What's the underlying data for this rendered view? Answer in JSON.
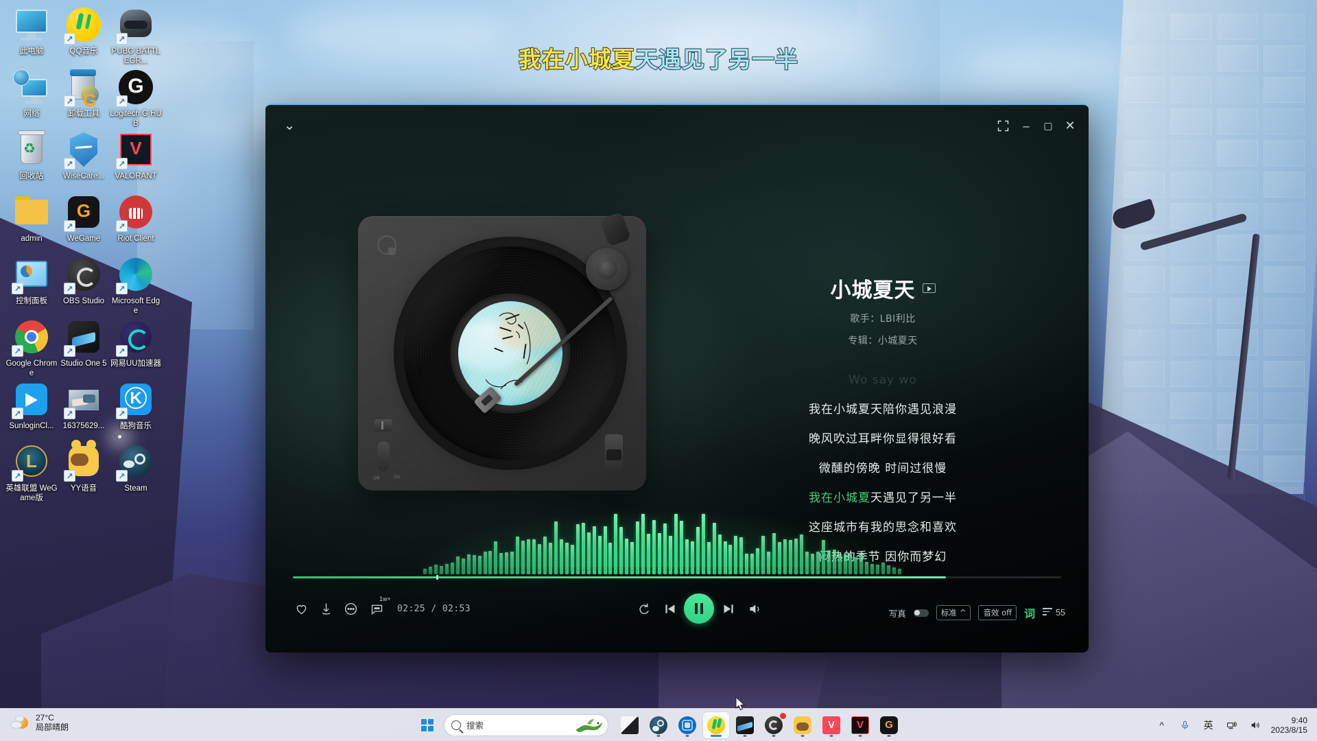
{
  "desktop": {
    "icons": [
      {
        "label": "此电脑",
        "art": "monitor"
      },
      {
        "label": "QQ音乐",
        "art": "qq"
      },
      {
        "label": "PUBG BATTLEGR...",
        "art": "pubg"
      },
      {
        "label": "网络",
        "art": "network"
      },
      {
        "label": "卸载工具",
        "art": "uninstall"
      },
      {
        "label": "Logitech G HUB",
        "art": "ghub"
      },
      {
        "label": "回收站",
        "art": "recyclebin"
      },
      {
        "label": "WiseCare...",
        "art": "wisecare"
      },
      {
        "label": "VALORANT",
        "art": "valorant"
      },
      {
        "label": "admin",
        "art": "folder"
      },
      {
        "label": "WeGame",
        "art": "wegame"
      },
      {
        "label": "Riot Client",
        "art": "riot"
      },
      {
        "label": "控制面板",
        "art": "cpanel"
      },
      {
        "label": "OBS Studio",
        "art": "obs"
      },
      {
        "label": "Microsoft Edge",
        "art": "edge"
      },
      {
        "label": "Google Chrome",
        "art": "chrome"
      },
      {
        "label": "Studio One 5",
        "art": "studioone"
      },
      {
        "label": "网易UU加速器",
        "art": "uu"
      },
      {
        "label": "SunloginCl...",
        "art": "sunlogin"
      },
      {
        "label": "16375629...",
        "art": "photo"
      },
      {
        "label": "酷狗音乐",
        "art": "kugou"
      },
      {
        "label": "英雄联盟 WeGame版",
        "art": "lol"
      },
      {
        "label": "YY语音",
        "art": "yy"
      },
      {
        "label": "Steam",
        "art": "steam"
      }
    ]
  },
  "desktop_lyric": {
    "sung": "我在小城夏",
    "unsung": "天遇见了另一半"
  },
  "player": {
    "titlebar": {
      "collapse_icon": "chevron-down",
      "expand_label": "⛶",
      "minimize_label": "–",
      "maximize_label": "▢",
      "close_label": "✕"
    },
    "song": {
      "title": "小城夏天",
      "artist_line": "歌手：LBI利比",
      "album_line": "专辑：小城夏天"
    },
    "lyrics": [
      {
        "text": "Wo say wo",
        "state": "faded"
      },
      {
        "text": "我在小城夏天陪你遇见浪漫",
        "state": "normal"
      },
      {
        "text": "晚风吹过耳畔你显得很好看",
        "state": "normal"
      },
      {
        "text": "微醺的傍晚 时间过很慢",
        "state": "normal"
      },
      {
        "text": "我在小城夏天遇见了另一半",
        "state": "active",
        "sung": "我在小城夏",
        "rest": "天遇见了另一半"
      },
      {
        "text": "这座城市有我的思念和喜欢",
        "state": "normal"
      },
      {
        "text": "闷热的季节 因你而梦幻",
        "state": "normal"
      }
    ],
    "controls": {
      "like": "like-icon",
      "download": "download-icon",
      "more": "more-icon",
      "comment": "comment-icon",
      "comment_count": "1w+",
      "time": "02:25 / 02:53",
      "elapsed": "02:25",
      "duration": "02:53",
      "progress_percent": 85,
      "repeat": "repeat-icon",
      "prev": "previous-icon",
      "play_state": "playing",
      "next": "next-icon",
      "volume": "volume-icon"
    },
    "options": {
      "photo_label": "写真",
      "photo_on": false,
      "quality_label": "标准",
      "quality_caret": "^",
      "effects_label": "音效 off",
      "lyric_label": "词",
      "playlist_count": "55"
    }
  },
  "taskbar": {
    "weather": {
      "temp": "27°C",
      "desc": "局部晴朗"
    },
    "search": {
      "placeholder": "搜索"
    },
    "apps": [
      {
        "name": "file-explorer",
        "active": false,
        "running": false
      },
      {
        "name": "steam",
        "active": false,
        "running": true
      },
      {
        "name": "sunlogin",
        "active": false,
        "running": true
      },
      {
        "name": "qq-music",
        "active": true,
        "running": true
      },
      {
        "name": "studio-one",
        "active": false,
        "running": true
      },
      {
        "name": "obs-studio",
        "active": false,
        "running": true
      },
      {
        "name": "yy-voice",
        "active": false,
        "running": true
      },
      {
        "name": "valorant",
        "active": false,
        "running": true
      },
      {
        "name": "valorant-2",
        "active": false,
        "running": true
      },
      {
        "name": "wegame",
        "active": false,
        "running": true
      }
    ],
    "tray": {
      "chevron": "^",
      "mic": "mic-icon",
      "ime": "英",
      "network": "network-icon",
      "volume": "volume-icon",
      "time": "9:40",
      "date": "2023/8/15"
    }
  }
}
